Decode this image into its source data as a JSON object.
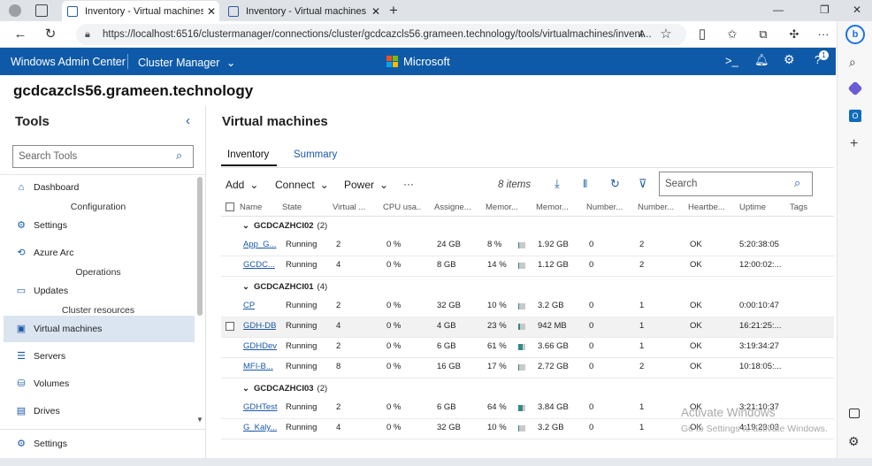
{
  "browser": {
    "tabs": [
      {
        "title": "Inventory - Virtual machines - Cl",
        "active": true
      },
      {
        "title": "Inventory - Virtual machines - Se",
        "active": false
      }
    ],
    "new_tab": "+",
    "url": "https://localhost:6516/clustermanager/connections/cluster/gcdcazcls56.grameen.technology/tools/virtualmachines/invent...",
    "window_controls": [
      "—",
      "❐",
      "✕"
    ]
  },
  "app": {
    "title": "Windows Admin Center",
    "section": "Cluster Manager",
    "brand": "Microsoft",
    "notification_count": "1"
  },
  "connection": {
    "name": "gcdcazcls56.grameen.technology"
  },
  "tools": {
    "title": "Tools",
    "search_placeholder": "Search Tools",
    "items": [
      {
        "label": "Dashboard",
        "icon": "house-icon"
      },
      {
        "group": "Configuration"
      },
      {
        "label": "Settings",
        "icon": "gear-icon"
      },
      {
        "label": "Azure Arc",
        "icon": "arc-icon"
      },
      {
        "group": "Operations"
      },
      {
        "label": "Updates",
        "icon": "monitor-icon"
      },
      {
        "group": "Cluster resources"
      },
      {
        "label": "Virtual machines",
        "icon": "vm-icon",
        "selected": true
      },
      {
        "label": "Servers",
        "icon": "server-icon"
      },
      {
        "label": "Volumes",
        "icon": "cylinder-icon"
      },
      {
        "label": "Drives",
        "icon": "drive-icon"
      }
    ],
    "footer_settings": "Settings"
  },
  "main": {
    "title": "Virtual machines",
    "tabs": [
      "Inventory",
      "Summary"
    ],
    "toolbar": {
      "add": "Add",
      "connect": "Connect",
      "power": "Power",
      "more": "···",
      "item_count": "8 items",
      "search_placeholder": "Search"
    },
    "columns": [
      "Name",
      "State",
      "Virtual ...",
      "CPU usa...",
      "Assigne...",
      "Memor...",
      "Memor...",
      "Number...",
      "Number...",
      "Heartbe...",
      "Uptime",
      "Tags"
    ],
    "groups": [
      {
        "name": "GCDCAZHCI02",
        "count": "(2)",
        "rows": [
          {
            "name": "App_G...",
            "state": "Running",
            "vcpu": "2",
            "cpu": "0 %",
            "assigned": "24 GB",
            "mem_pct": "8 %",
            "mem_frac": 0.08,
            "mem": "1.92 GB",
            "n1": "0",
            "n2": "2",
            "hb": "OK",
            "uptime": "5:20:38:05",
            "tags": ""
          },
          {
            "name": "GCDC...",
            "state": "Running",
            "vcpu": "4",
            "cpu": "0 %",
            "assigned": "8 GB",
            "mem_pct": "14 %",
            "mem_frac": 0.14,
            "mem": "1.12 GB",
            "n1": "0",
            "n2": "2",
            "hb": "OK",
            "uptime": "12:00:02:...",
            "tags": ""
          }
        ]
      },
      {
        "name": "GCDCAZHCI01",
        "count": "(4)",
        "rows": [
          {
            "name": "CP",
            "state": "Running",
            "vcpu": "2",
            "cpu": "0 %",
            "assigned": "32 GB",
            "mem_pct": "10 %",
            "mem_frac": 0.1,
            "mem": "3.2 GB",
            "n1": "0",
            "n2": "1",
            "hb": "OK",
            "uptime": "0:00:10:47",
            "tags": ""
          },
          {
            "name": "GDH-DB",
            "state": "Running",
            "vcpu": "4",
            "cpu": "0 %",
            "assigned": "4 GB",
            "mem_pct": "23 %",
            "mem_frac": 0.23,
            "mem": "942 MB",
            "n1": "0",
            "n2": "1",
            "hb": "OK",
            "uptime": "16:21:25:...",
            "tags": "",
            "hover": true
          },
          {
            "name": "GDHDev",
            "state": "Running",
            "vcpu": "2",
            "cpu": "0 %",
            "assigned": "6 GB",
            "mem_pct": "61 %",
            "mem_frac": 0.61,
            "mem": "3.66 GB",
            "n1": "0",
            "n2": "1",
            "hb": "OK",
            "uptime": "3:19:34:27",
            "tags": ""
          },
          {
            "name": "MFI-B...",
            "state": "Running",
            "vcpu": "8",
            "cpu": "0 %",
            "assigned": "16 GB",
            "mem_pct": "17 %",
            "mem_frac": 0.17,
            "mem": "2.72 GB",
            "n1": "0",
            "n2": "2",
            "hb": "OK",
            "uptime": "10:18:05:...",
            "tags": ""
          }
        ]
      },
      {
        "name": "GCDCAZHCI03",
        "count": "(2)",
        "rows": [
          {
            "name": "GDHTest",
            "state": "Running",
            "vcpu": "2",
            "cpu": "0 %",
            "assigned": "6 GB",
            "mem_pct": "64 %",
            "mem_frac": 0.64,
            "mem": "3.84 GB",
            "n1": "0",
            "n2": "1",
            "hb": "OK",
            "uptime": "3:21:10:37",
            "tags": ""
          },
          {
            "name": "G_Kaly...",
            "state": "Running",
            "vcpu": "4",
            "cpu": "0 %",
            "assigned": "32 GB",
            "mem_pct": "10 %",
            "mem_frac": 0.1,
            "mem": "3.2 GB",
            "n1": "0",
            "n2": "1",
            "hb": "OK",
            "uptime": "4:19:23:03",
            "tags": ""
          }
        ]
      }
    ]
  },
  "watermark": {
    "line1": "Activate Windows",
    "line2": "Go to Settings to activate Windows."
  },
  "colors": {
    "header_blue": "#0f5aa8",
    "link": "#1a5aa8",
    "selected_bg": "#dbe5f1",
    "bar_fill": "#2f8a8a"
  }
}
